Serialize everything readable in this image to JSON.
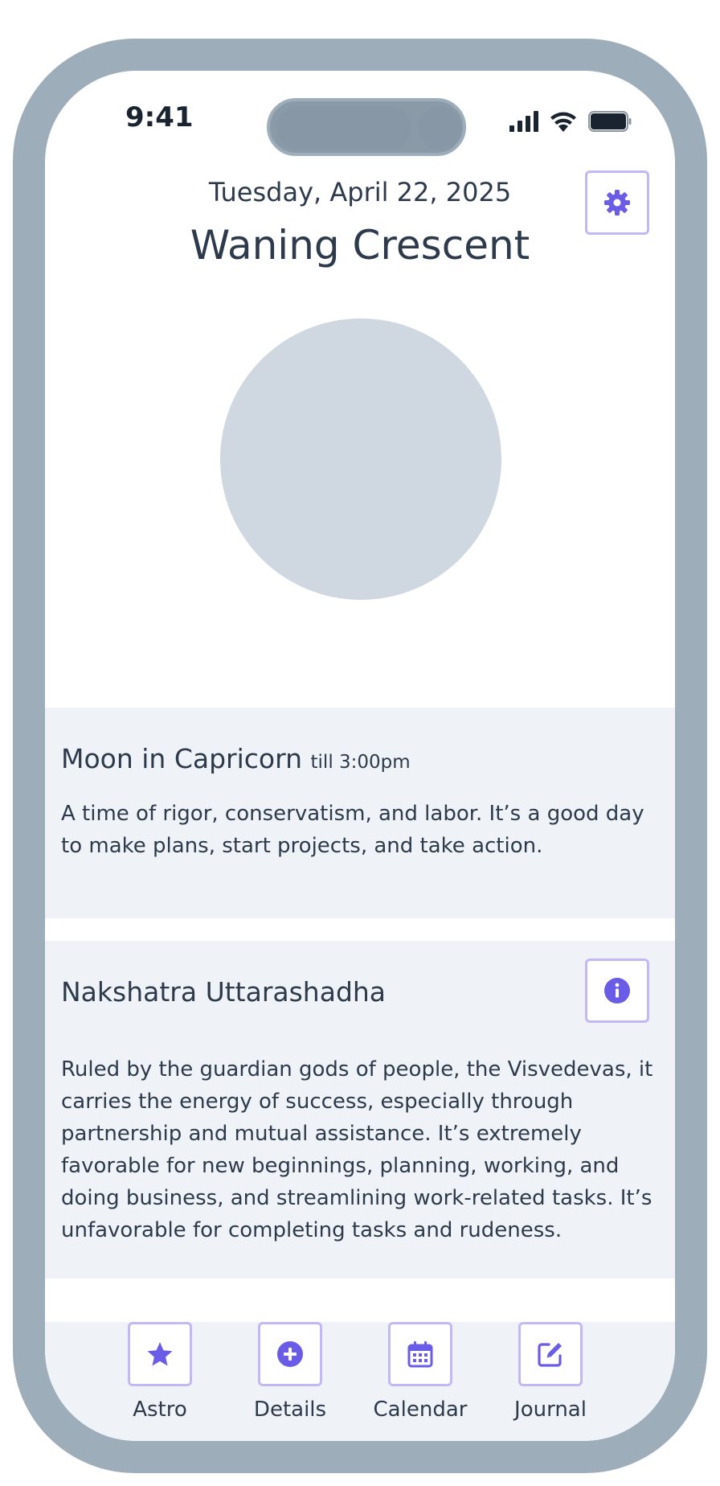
{
  "status_bar": {
    "time": "9:41"
  },
  "header": {
    "date": "Tuesday, April 22, 2025",
    "phase": "Waning Crescent"
  },
  "moon_sign": {
    "title": "Moon in Capricorn",
    "until": "till 3:00pm",
    "description": "A time of rigor, conservatism, and labor. It’s a good day to make plans, start projects, and take action."
  },
  "nakshatra": {
    "title": "Nakshatra Uttarashadha",
    "description": "Ruled by the guardian gods of people, the Visvedevas, it carries the energy of success, especially through partnership and mutual assistance. It’s extremely favorable for new beginnings, planning, working, and doing business, and streamlining work-related tasks. It’s unfavorable for completing tasks and rudeness."
  },
  "tabs": [
    {
      "label": "Astro",
      "icon": "star-icon"
    },
    {
      "label": "Details",
      "icon": "plus-circle-icon"
    },
    {
      "label": "Calendar",
      "icon": "calendar-icon"
    },
    {
      "label": "Journal",
      "icon": "edit-icon"
    }
  ],
  "colors": {
    "accent": "#6b5ce7",
    "frame": "#9eadba",
    "card_bg": "#eff3f7",
    "moon": "#cfd8e0"
  }
}
